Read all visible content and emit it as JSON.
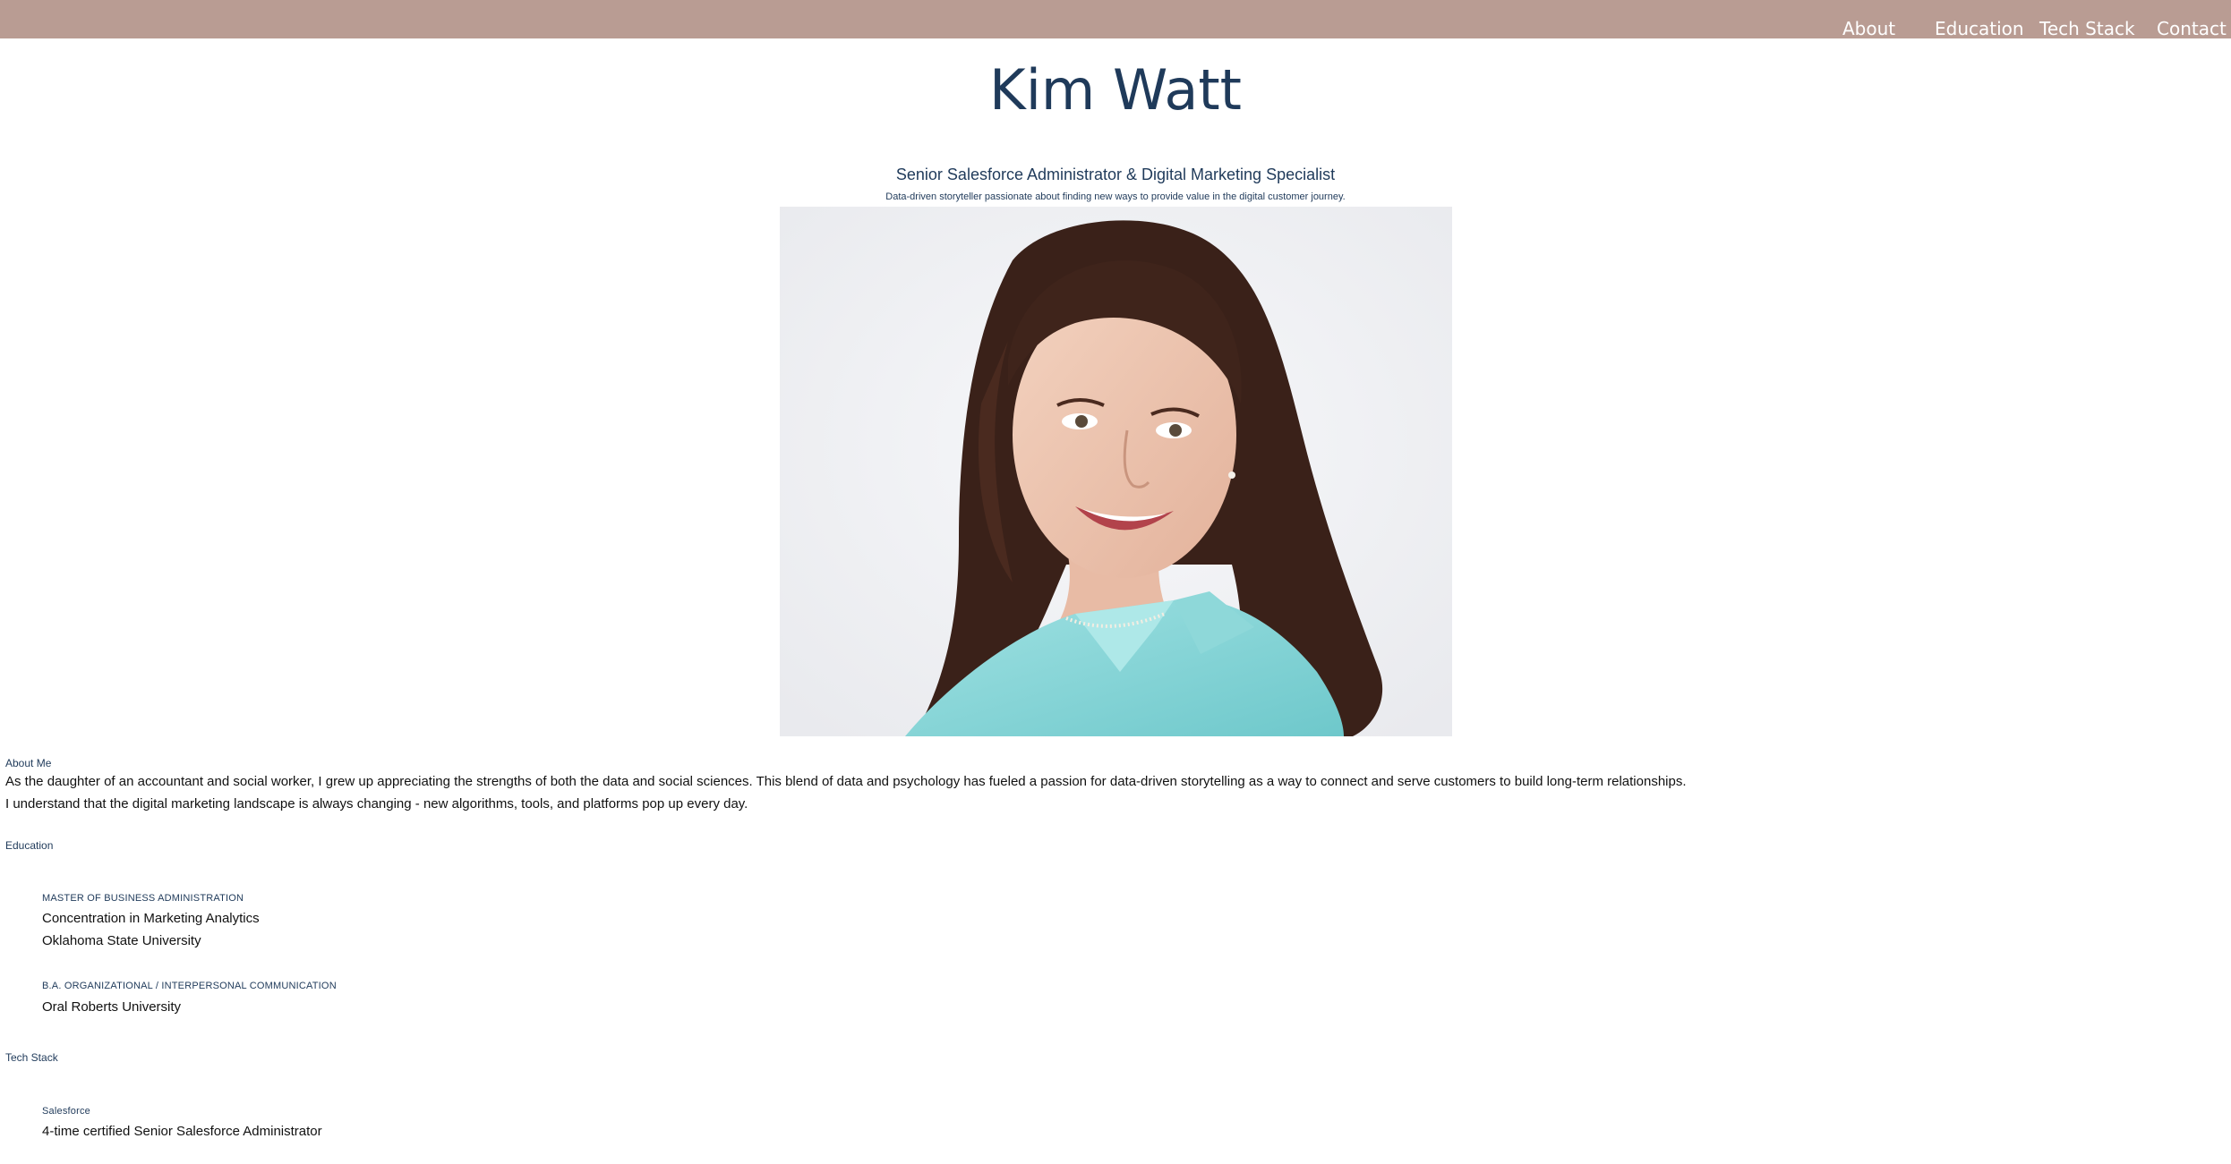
{
  "nav": {
    "items": [
      "About",
      "Education",
      "Tech Stack",
      "Contact"
    ]
  },
  "header": {
    "name": "Kim Watt",
    "title": "Senior Salesforce Administrator & Digital Marketing Specialist",
    "tagline": "Data-driven storyteller passionate about finding new ways to provide value in the digital customer journey."
  },
  "about": {
    "label": "About Me",
    "paragraphs": [
      "As the daughter of an accountant and social worker, I grew up appreciating the strengths of both the data and social sciences. This blend of data and psychology has fueled a passion for data-driven storytelling as a way to connect and serve customers to build long-term relationships.",
      "I understand that the digital marketing landscape is always changing - new algorithms, tools, and platforms pop up every day."
    ]
  },
  "education": {
    "label": "Education",
    "entries": [
      {
        "degree": "MASTER OF BUSINESS ADMINISTRATION",
        "lines": [
          "Concentration in Marketing Analytics",
          "Oklahoma State University"
        ]
      },
      {
        "degree": "B.A. ORGANIZATIONAL / INTERPERSONAL COMMUNICATION",
        "lines": [
          "Oral Roberts University"
        ]
      }
    ]
  },
  "tech_stack": {
    "label": "Tech Stack",
    "entries": [
      {
        "name": "Salesforce",
        "lines": [
          "4-time certified Senior Salesforce Administrator"
        ]
      }
    ]
  },
  "colors": {
    "nav_bg": "#b99c93",
    "heading": "#1f3a5a",
    "shirt": "#7fd3d4",
    "hair": "#3a2119"
  }
}
